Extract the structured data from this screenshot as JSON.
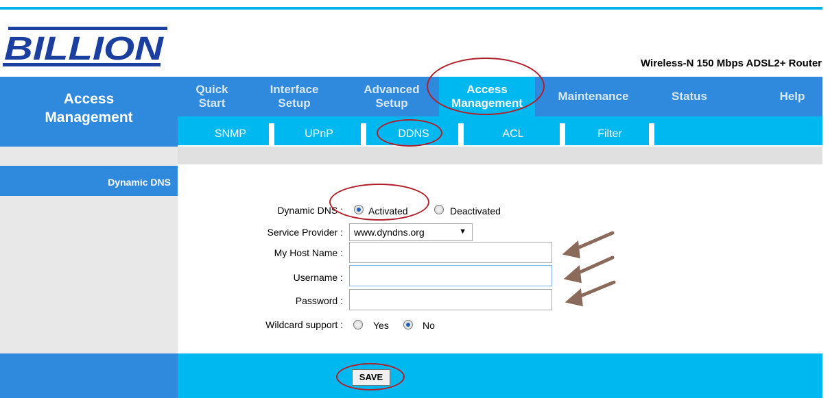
{
  "brand": {
    "logo": "BILLION",
    "product_title": "Wireless-N 150 Mbps ADSL2+ Router"
  },
  "section_title": {
    "line1": "Access",
    "line2": "Management"
  },
  "nav": {
    "items": [
      {
        "line1": "Quick",
        "line2": "Start"
      },
      {
        "line1": "Interface",
        "line2": "Setup"
      },
      {
        "line1": "Advanced",
        "line2": "Setup"
      },
      {
        "line1": "Access",
        "line2": "Management"
      },
      {
        "line1": "Maintenance",
        "line2": ""
      },
      {
        "line1": "Status",
        "line2": ""
      },
      {
        "line1": "Help",
        "line2": ""
      }
    ]
  },
  "subnav": {
    "items": [
      "SNMP",
      "UPnP",
      "DDNS",
      "ACL",
      "Filter"
    ]
  },
  "sidebar": {
    "item": "Dynamic DNS"
  },
  "form": {
    "dynamic_dns": {
      "label": "Dynamic DNS :",
      "opt_on": "Activated",
      "opt_off": "Deactivated"
    },
    "service_provider": {
      "label": "Service Provider :",
      "value": "www.dyndns.org"
    },
    "host_name": {
      "label": "My Host Name :",
      "value": ""
    },
    "username": {
      "label": "Username :",
      "value": ""
    },
    "password": {
      "label": "Password :",
      "value": ""
    },
    "wildcard": {
      "label": "Wildcard support :",
      "opt_yes": "Yes",
      "opt_no": "No"
    }
  },
  "footer": {
    "save_label": "SAVE"
  },
  "colors": {
    "nav_blue": "#2f89dd",
    "sub_cyan": "#00b8f0",
    "annotation_red": "#b0202a",
    "arrow_brown": "#8a6a5a"
  }
}
